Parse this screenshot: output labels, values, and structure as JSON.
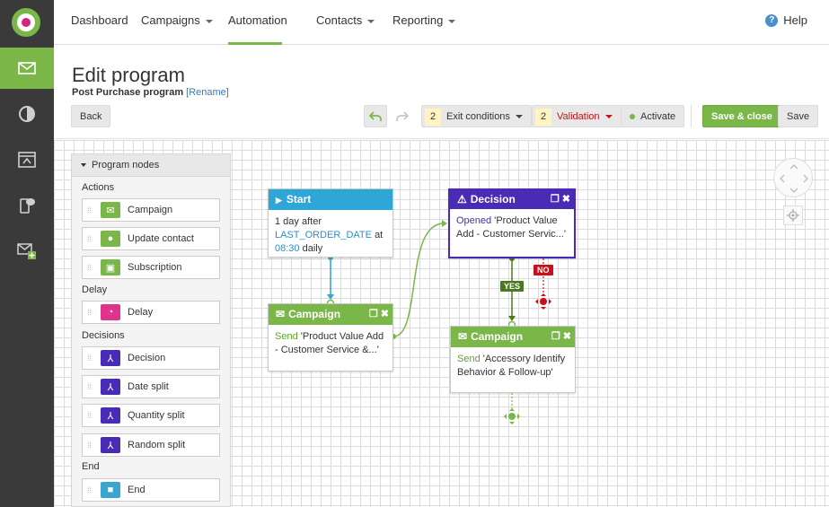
{
  "topnav": {
    "items": [
      {
        "label": "Dashboard"
      },
      {
        "label": "Campaigns"
      },
      {
        "label": "Automation"
      },
      {
        "label": "Contacts"
      },
      {
        "label": "Reporting"
      }
    ],
    "help_label": "Help",
    "active": "Automation"
  },
  "sidebar": {
    "items": [
      {
        "icon": "envelope-icon",
        "active": true
      },
      {
        "icon": "pie-chart-icon"
      },
      {
        "icon": "browser-window-icon"
      },
      {
        "icon": "mobile-chat-icon"
      },
      {
        "icon": "envelope-plus-icon"
      }
    ]
  },
  "page": {
    "title": "Edit program",
    "subtitle": "Post Purchase program",
    "rename_label": "[Rename]"
  },
  "toolbar": {
    "back_label": "Back",
    "exit_count": "2",
    "exit_label": "Exit conditions",
    "validation_count": "2",
    "validation_label": "Validation",
    "activate_label": "Activate",
    "save_close_label": "Save & close",
    "save_label": "Save"
  },
  "palette": {
    "title": "Program nodes",
    "groups": {
      "actions": "Actions",
      "delay": "Delay",
      "decisions": "Decisions",
      "end": "End"
    },
    "nodes": [
      {
        "label": "Campaign",
        "color": "#7ab648",
        "icon": "envelope-icon"
      },
      {
        "label": "Update contact",
        "color": "#7ab648",
        "icon": "person-icon"
      },
      {
        "label": "Subscription",
        "color": "#7ab648",
        "icon": "envelopes-icon"
      },
      {
        "label": "Delay",
        "color": "#e0338c",
        "icon": "timer-icon"
      },
      {
        "label": "Decision",
        "color": "#4a2bb5",
        "icon": "fork-icon"
      },
      {
        "label": "Date split",
        "color": "#4a2bb5",
        "icon": "fork-icon"
      },
      {
        "label": "Quantity split",
        "color": "#4a2bb5",
        "icon": "fork-icon"
      },
      {
        "label": "Random split",
        "color": "#4a2bb5",
        "icon": "fork-icon"
      },
      {
        "label": "End",
        "color": "#3aa6d0",
        "icon": "stop-icon"
      }
    ]
  },
  "flow": {
    "start": {
      "title": "Start",
      "line1": "1 day after",
      "field": "LAST_ORDER_DATE",
      "at": "at",
      "time": "08:30",
      "freq": "daily"
    },
    "campaign1": {
      "title": "Campaign",
      "verb": "Send",
      "text": "'Product Value Add - Customer Service &...'"
    },
    "decision": {
      "title": "Decision",
      "verb": "Opened",
      "text": "'Product Value Add - Customer Servic...'"
    },
    "campaign2": {
      "title": "Campaign",
      "verb": "Send",
      "text": "'Accessory Identify Behavior & Follow-up'"
    },
    "yes_label": "YES",
    "no_label": "NO"
  },
  "colors": {
    "green": "#7ab648",
    "purple": "#4a2bb5",
    "blue": "#2ea7d6",
    "red": "#c9101b"
  }
}
